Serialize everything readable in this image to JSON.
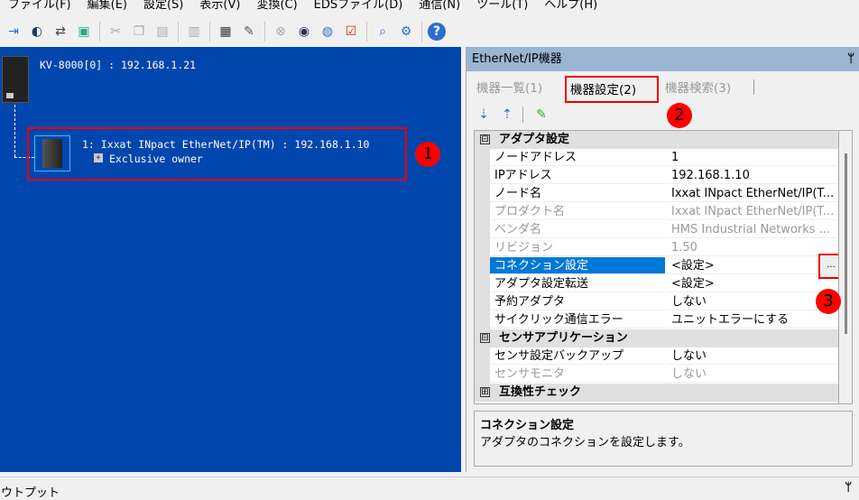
{
  "menu": [
    "ファイル(F)",
    "編集(E)",
    "設定(S)",
    "表示(V)",
    "変換(C)",
    "EDSファイル(D)",
    "通信(N)",
    "ツール(T)",
    "ヘルプ(H)"
  ],
  "toolbar_icons": [
    "import-icon",
    "monitor-icon",
    "network-transfer-icon",
    "pc-display-icon",
    "cut-icon",
    "copy-icon",
    "paste-icon",
    "unit-icon",
    "sd-icon",
    "wrench-icon",
    "clear-icon",
    "dm-rlm-icon",
    "eip-icon",
    "check-report-icon",
    "tree-search-icon",
    "settings-icon",
    "help-icon"
  ],
  "network": {
    "plc_label": "KV-8000[0] : 192.168.1.21",
    "device_label": "1: Ixxat INpact EtherNet/IP(TM) : 192.168.1.10",
    "connection_label": "Exclusive owner"
  },
  "panel": {
    "title": "EtherNet/IP機器",
    "pin": "ᛘ",
    "tabs": [
      "機器一覧(1)",
      "機器設定(2)",
      "機器検索(3)"
    ]
  },
  "grid": {
    "categories": [
      {
        "sign": "⊟",
        "label": "アダプタ設定"
      },
      {
        "sign": "⊟",
        "label": "センサアプリケーション"
      },
      {
        "sign": "⊞",
        "label": "互換性チェック"
      }
    ],
    "rows": [
      {
        "name": "ノードアドレス",
        "value": "1"
      },
      {
        "name": "IPアドレス",
        "value": "192.168.1.10"
      },
      {
        "name": "ノード名",
        "value": "Ixxat INpact EtherNet/IP(T..."
      },
      {
        "name": "プロダクト名",
        "value": "Ixxat INpact EtherNet/IP(T..."
      },
      {
        "name": "ベンダ名",
        "value": "HMS Industrial Networks ..."
      },
      {
        "name": "リビジョン",
        "value": "1.50"
      },
      {
        "name": "コネクション設定",
        "value": "<設定>"
      },
      {
        "name": "アダプタ設定転送",
        "value": "<設定>"
      },
      {
        "name": "予約アダプタ",
        "value": "しない"
      },
      {
        "name": "サイクリック通信エラー",
        "value": "ユニットエラーにする"
      },
      {
        "name": "センサ設定バックアップ",
        "value": "しない"
      },
      {
        "name": "センサモニタ",
        "value": "しない"
      }
    ],
    "ellipsis": "..."
  },
  "description": {
    "title": "コネクション設定",
    "text": "アダプタのコネクションを設定します。"
  },
  "badges": [
    "1",
    "2",
    "3"
  ],
  "output": {
    "title": "アウトプット"
  }
}
